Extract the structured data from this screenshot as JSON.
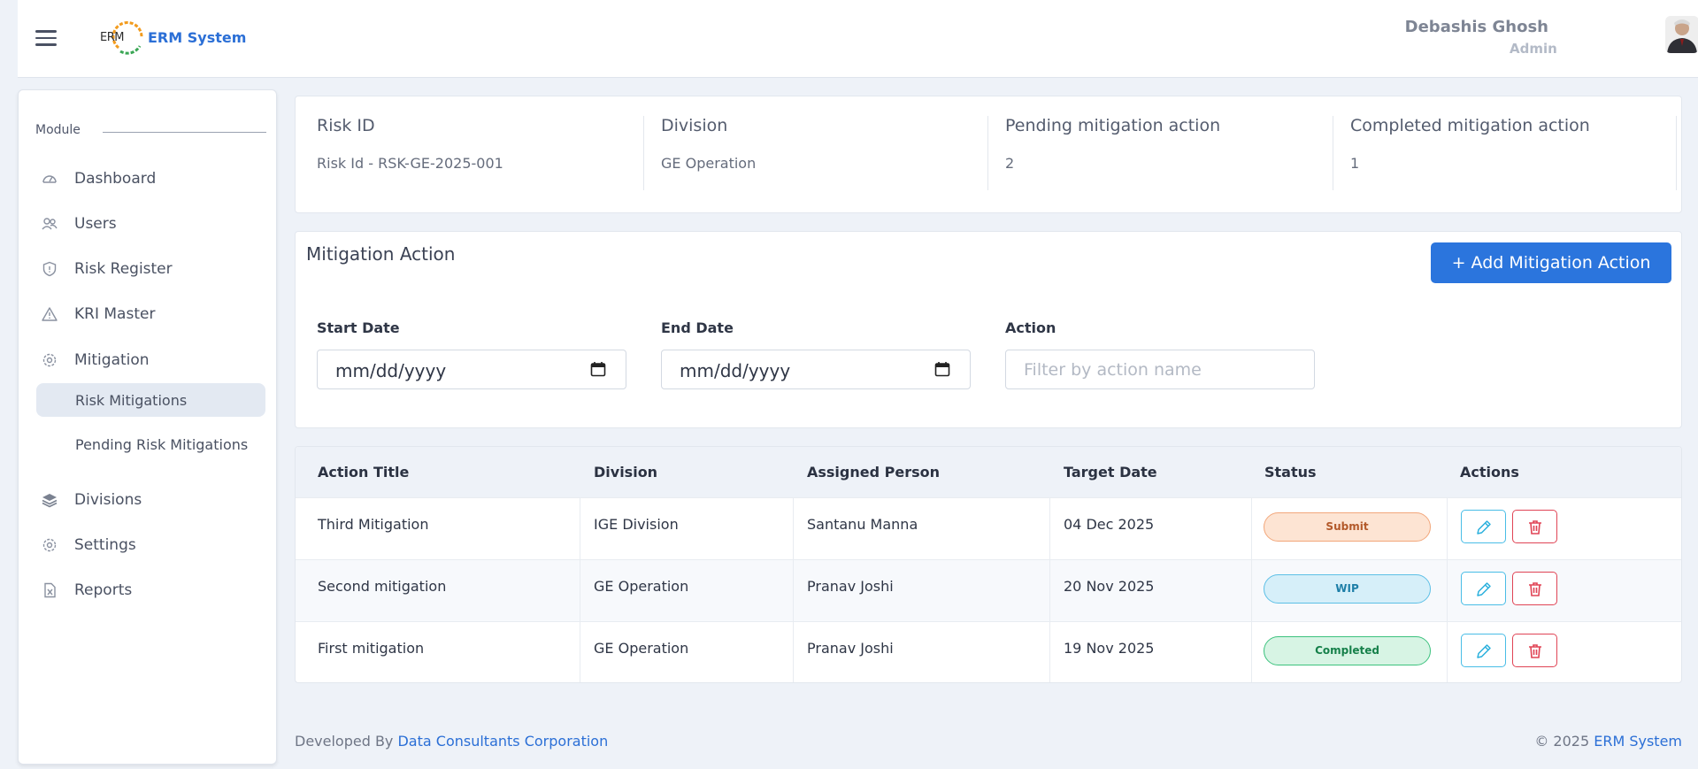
{
  "header": {
    "logo_text": "ERM",
    "app_title": "ERM System",
    "user_name": "Debashis Ghosh",
    "user_role": "Admin"
  },
  "sidebar": {
    "section_label": "Module",
    "items": [
      {
        "label": "Dashboard",
        "icon": "dashboard-gauge-icon"
      },
      {
        "label": "Users",
        "icon": "users-icon"
      },
      {
        "label": "Risk Register",
        "icon": "shield-icon"
      },
      {
        "label": "KRI Master",
        "icon": "warning-triangle-icon"
      },
      {
        "label": "Mitigation",
        "icon": "gear-icon"
      },
      {
        "label": "Divisions",
        "icon": "layers-icon"
      },
      {
        "label": "Settings",
        "icon": "gear-icon"
      },
      {
        "label": "Reports",
        "icon": "file-excel-icon"
      }
    ],
    "sub_items": [
      {
        "label": "Risk Mitigations",
        "active": true
      },
      {
        "label": "Pending Risk Mitigations",
        "active": false
      }
    ]
  },
  "info": {
    "risk_id_title": "Risk ID",
    "risk_id_value": "Risk Id - RSK-GE-2025-001",
    "division_title": "Division",
    "division_value": "GE Operation",
    "pending_title": "Pending mitigation action",
    "pending_value": "2",
    "completed_title": "Completed mitigation action",
    "completed_value": "1"
  },
  "mitigation": {
    "title": "Mitigation Action",
    "add_button": "+ Add Mitigation Action",
    "start_date_label": "Start Date",
    "start_date_value": "mm/dd/yyyy",
    "end_date_label": "End Date",
    "end_date_value": "mm/dd/yyyy",
    "action_label": "Action",
    "action_placeholder": "Filter by action name"
  },
  "table": {
    "headers": [
      "Action Title",
      "Division",
      "Assigned Person",
      "Target Date",
      "Status",
      "Actions"
    ],
    "rows": [
      {
        "title": "Third Mitigation",
        "division": "IGE Division",
        "person": "Santanu Manna",
        "date": "04 Dec 2025",
        "status": "Submit"
      },
      {
        "title": "Second mitigation",
        "division": "GE Operation",
        "person": "Pranav Joshi",
        "date": "20 Nov 2025",
        "status": "WIP"
      },
      {
        "title": "First mitigation",
        "division": "GE Operation",
        "person": "Pranav Joshi",
        "date": "19 Nov 2025",
        "status": "Completed"
      }
    ]
  },
  "footer": {
    "developed_by": "Developed By ",
    "company": "Data Consultants Corporation",
    "copyright": "© 2025 ",
    "product": "ERM System"
  },
  "colors": {
    "accent": "#2b75dd",
    "submit": "#f2a67a",
    "wip": "#5cbfe6",
    "completed": "#3cc27e",
    "delete": "#e04455"
  }
}
